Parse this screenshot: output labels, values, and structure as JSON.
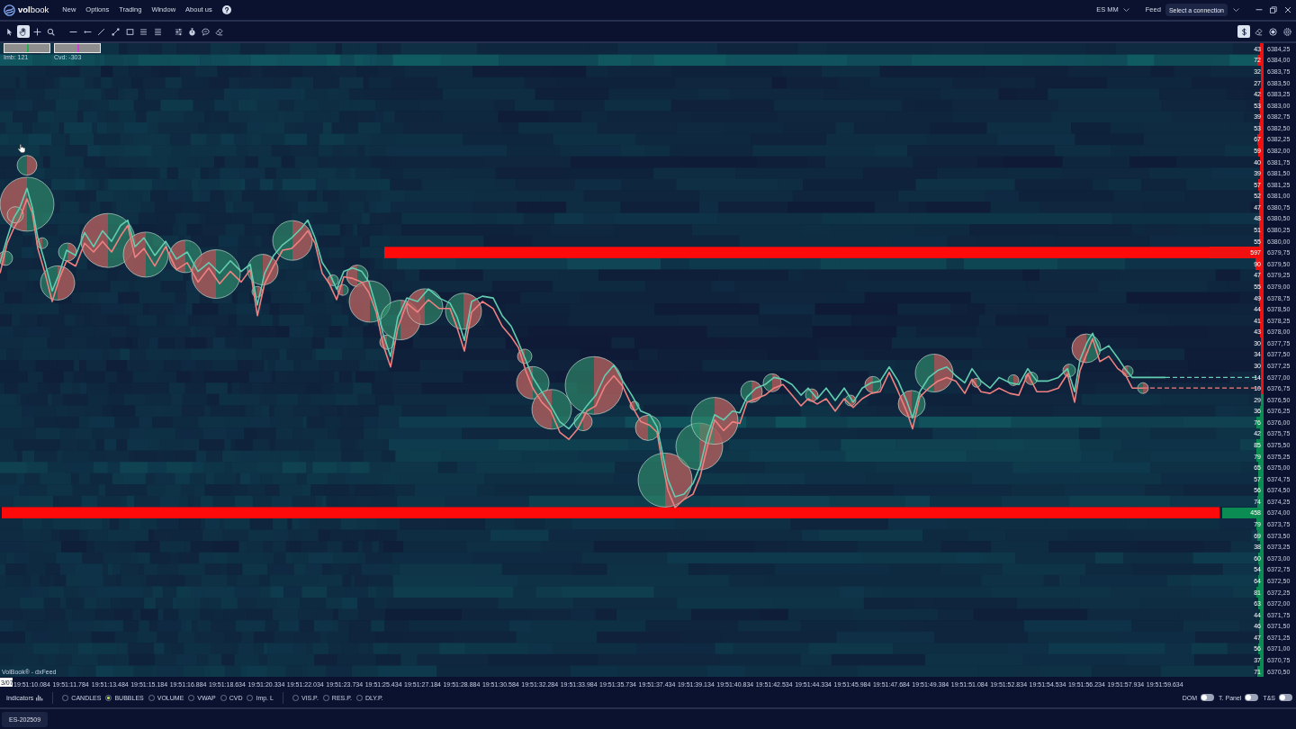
{
  "title_bar": {
    "logo": "**vol**book",
    "menu": [
      {
        "label": "New"
      },
      {
        "label": "Options"
      },
      {
        "label": "Trading"
      },
      {
        "label": "Window"
      },
      {
        "label": "About us"
      }
    ],
    "instrument": "ES MM",
    "feed_label": "Feed",
    "connection": "Select a connection"
  },
  "toolbar": {
    "left_tools": [
      {
        "selected": false
      },
      {
        "selected": true
      },
      {
        "selected": false
      },
      {
        "selected": false
      },
      {
        "selected": false
      },
      {
        "selected": false
      },
      {
        "selected": false
      },
      {
        "selected": false
      },
      {
        "selected": false
      },
      {
        "selected": false
      },
      {
        "selected": false
      },
      {
        "selected": false
      },
      {
        "selected": false
      },
      {
        "selected": false
      },
      {
        "selected": false
      }
    ],
    "right_tools": [
      {
        "selected": true
      },
      {
        "selected": false
      },
      {
        "selected": false
      },
      {
        "selected": false
      }
    ]
  },
  "chart": {
    "gauges": [
      {
        "label": "Imb: 121",
        "level": 0.5,
        "color": "#22b14c"
      },
      {
        "label": "Cvd: -303",
        "level": 0.5,
        "color": "#d63cd6"
      }
    ],
    "source": "VolBook® - dxFeed",
    "ladder": [
      {
        "price": "6384,25",
        "quantity": "43",
        "color": "#f01010"
      },
      {
        "price": "6384,00",
        "quantity": "72",
        "color": "#f01010"
      },
      {
        "price": "6383,75",
        "quantity": "32",
        "color": "#f01010"
      },
      {
        "price": "6383,50",
        "quantity": "27",
        "color": "#f01010"
      },
      {
        "price": "6383,25",
        "quantity": "42",
        "color": "#f01010"
      },
      {
        "price": "6383,00",
        "quantity": "53",
        "color": "#f01010"
      },
      {
        "price": "6382,75",
        "quantity": "39",
        "color": "#f01010"
      },
      {
        "price": "6382,50",
        "quantity": "53",
        "color": "#f01010"
      },
      {
        "price": "6382,25",
        "quantity": "67",
        "color": "#f01010"
      },
      {
        "price": "6382,00",
        "quantity": "59",
        "color": "#f01010"
      },
      {
        "price": "6381,75",
        "quantity": "40",
        "color": "#f01010"
      },
      {
        "price": "6381,50",
        "quantity": "39",
        "color": "#f01010"
      },
      {
        "price": "6381,25",
        "quantity": "57",
        "color": "#f01010"
      },
      {
        "price": "6381,00",
        "quantity": "52",
        "color": "#f01010"
      },
      {
        "price": "6380,75",
        "quantity": "47",
        "color": "#f01010"
      },
      {
        "price": "6380,50",
        "quantity": "48",
        "color": "#f01010"
      },
      {
        "price": "6380,25",
        "quantity": "51",
        "color": "#f01010"
      },
      {
        "price": "6380,00",
        "quantity": "55",
        "color": "#f01010"
      },
      {
        "price": "6379,75",
        "quantity": "597",
        "color": "#f01010"
      },
      {
        "price": "6379,50",
        "quantity": "90",
        "color": "#f01010"
      },
      {
        "price": "6379,25",
        "quantity": "47",
        "color": "#f01010"
      },
      {
        "price": "6379,00",
        "quantity": "55",
        "color": "#f01010"
      },
      {
        "price": "6378,75",
        "quantity": "49",
        "color": "#f01010"
      },
      {
        "price": "6378,50",
        "quantity": "44",
        "color": "#f01010"
      },
      {
        "price": "6378,25",
        "quantity": "41",
        "color": "#f01010"
      },
      {
        "price": "6378,00",
        "quantity": "43",
        "color": "#f01010"
      },
      {
        "price": "6377,75",
        "quantity": "30",
        "color": "#f01010"
      },
      {
        "price": "6377,50",
        "quantity": "34",
        "color": "#f01010"
      },
      {
        "price": "6377,25",
        "quantity": "30",
        "color": "#f01010"
      },
      {
        "price": "6377,00",
        "quantity": "14",
        "color": "#f01010"
      },
      {
        "price": "6376,75",
        "quantity": "10",
        "color": "#f01010"
      },
      {
        "price": "6376,50",
        "quantity": "29",
        "color": "#0b8c52"
      },
      {
        "price": "6376,25",
        "quantity": "36",
        "color": "#0b8c52"
      },
      {
        "price": "6376,00",
        "quantity": "76",
        "color": "#0b8c52"
      },
      {
        "price": "6375,75",
        "quantity": "42",
        "color": "#0b8c52"
      },
      {
        "price": "6375,50",
        "quantity": "85",
        "color": "#0b8c52"
      },
      {
        "price": "6375,25",
        "quantity": "79",
        "color": "#0b8c52"
      },
      {
        "price": "6375,00",
        "quantity": "65",
        "color": "#0b8c52"
      },
      {
        "price": "6374,75",
        "quantity": "57",
        "color": "#0b8c52"
      },
      {
        "price": "6374,50",
        "quantity": "56",
        "color": "#0b8c52"
      },
      {
        "price": "6374,25",
        "quantity": "74",
        "color": "#0b8c52"
      },
      {
        "price": "6374,00",
        "quantity": "458",
        "color": "#0b8c52"
      },
      {
        "price": "6373,75",
        "quantity": "79",
        "color": "#0b8c52"
      },
      {
        "price": "6373,50",
        "quantity": "69",
        "color": "#0b8c52"
      },
      {
        "price": "6373,25",
        "quantity": "38",
        "color": "#0b8c52"
      },
      {
        "price": "6373,00",
        "quantity": "60",
        "color": "#0b8c52"
      },
      {
        "price": "6372,75",
        "quantity": "54",
        "color": "#0b8c52"
      },
      {
        "price": "6372,50",
        "quantity": "64",
        "color": "#0b8c52"
      },
      {
        "price": "6372,25",
        "quantity": "81",
        "color": "#0b8c52"
      },
      {
        "price": "6372,00",
        "quantity": "63",
        "color": "#0b8c52"
      },
      {
        "price": "6371,75",
        "quantity": "44",
        "color": "#0b8c52"
      },
      {
        "price": "6371,50",
        "quantity": "46",
        "color": "#0b8c52"
      },
      {
        "price": "6371,25",
        "quantity": "47",
        "color": "#0b8c52"
      },
      {
        "price": "6371,00",
        "quantity": "56",
        "color": "#0b8c52"
      },
      {
        "price": "6370,75",
        "quantity": "37",
        "color": "#0b8c52"
      },
      {
        "price": "6370,50",
        "quantity": "71",
        "color": "#0b8c52"
      }
    ]
  },
  "time_axis": {
    "date": "3/07",
    "times": [
      "19:51:10.084",
      "19:51:11.784",
      "19:51:13.484",
      "19:51:15.184",
      "19:51:16.884",
      "19:51:18.634",
      "19:51:20.334",
      "19:51:22.034",
      "19:51:23.734",
      "19:51:25.434",
      "19:51:27.184",
      "19:51:28.884",
      "19:51:30.584",
      "19:51:32.284",
      "19:51:33.984",
      "19:51:35.734",
      "19:51:37.434",
      "19:51:39.134",
      "19:51:40.834",
      "19:51:42.534",
      "19:51:44.334",
      "19:51:45.984",
      "19:51:47.684",
      "19:51:49.384",
      "19:51:51.084",
      "19:51:52.834",
      "19:51:54.534",
      "19:51:56.234",
      "19:51:57.934",
      "19:51:59.634"
    ]
  },
  "indicators": {
    "label": "Indicators",
    "groups": [
      {
        "options": [
          {
            "label": "CANDLES",
            "selected": false
          },
          {
            "label": "BUBBLES",
            "selected": true
          },
          {
            "label": "VOLUME",
            "selected": false
          },
          {
            "label": "VWAP",
            "selected": false
          },
          {
            "label": "CVD",
            "selected": false
          },
          {
            "label": "Imp. L",
            "selected": false
          }
        ]
      },
      {
        "options": [
          {
            "label": "VIS.P.",
            "selected": false
          },
          {
            "label": "RES.P.",
            "selected": false
          },
          {
            "label": "DLY.P.",
            "selected": false
          }
        ]
      }
    ],
    "toggles": [
      {
        "label": "DOM",
        "on": false
      },
      {
        "label": "T. Panel",
        "on": false
      },
      {
        "label": "T&S",
        "on": false
      }
    ]
  },
  "instrument_tabs": [
    {
      "label": "ES-202509",
      "selected": true
    }
  ]
}
